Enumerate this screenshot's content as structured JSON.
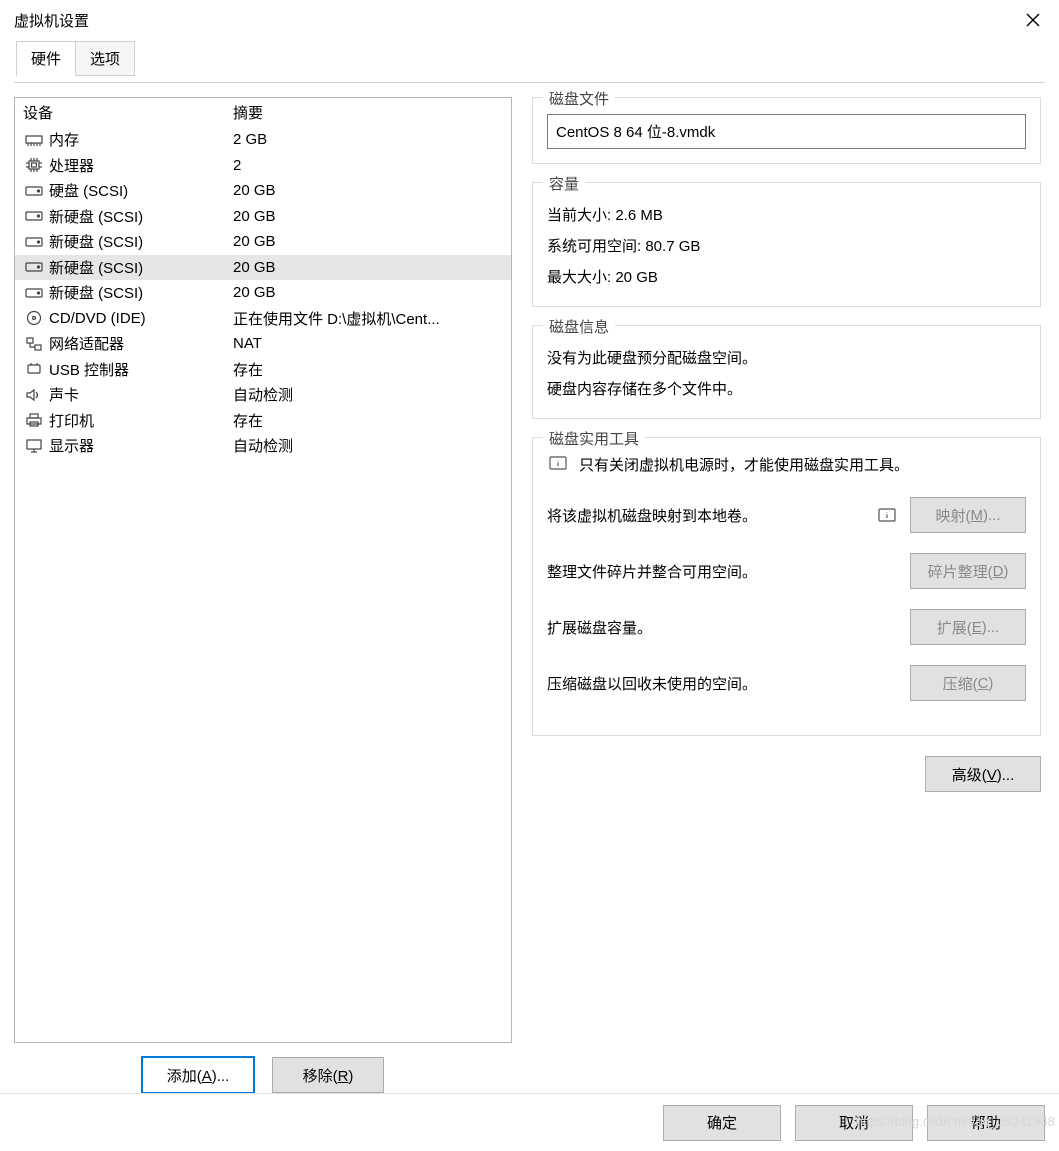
{
  "window": {
    "title": "虚拟机设置"
  },
  "tabs": [
    {
      "label": "硬件",
      "active": true
    },
    {
      "label": "选项",
      "active": false
    }
  ],
  "deviceList": {
    "header": {
      "device": "设备",
      "summary": "摘要"
    },
    "items": [
      {
        "icon": "memory",
        "name": "内存",
        "summary": "2 GB",
        "selected": false
      },
      {
        "icon": "cpu",
        "name": "处理器",
        "summary": "2",
        "selected": false
      },
      {
        "icon": "disk",
        "name": "硬盘 (SCSI)",
        "summary": "20 GB",
        "selected": false
      },
      {
        "icon": "disk",
        "name": "新硬盘 (SCSI)",
        "summary": "20 GB",
        "selected": false
      },
      {
        "icon": "disk",
        "name": "新硬盘 (SCSI)",
        "summary": "20 GB",
        "selected": false
      },
      {
        "icon": "disk",
        "name": "新硬盘 (SCSI)",
        "summary": "20 GB",
        "selected": true
      },
      {
        "icon": "disk",
        "name": "新硬盘 (SCSI)",
        "summary": "20 GB",
        "selected": false
      },
      {
        "icon": "cd",
        "name": "CD/DVD (IDE)",
        "summary": "正在使用文件 D:\\虚拟机\\Cent...",
        "selected": false
      },
      {
        "icon": "net",
        "name": "网络适配器",
        "summary": "NAT",
        "selected": false
      },
      {
        "icon": "usb",
        "name": "USB 控制器",
        "summary": "存在",
        "selected": false
      },
      {
        "icon": "sound",
        "name": "声卡",
        "summary": "自动检测",
        "selected": false
      },
      {
        "icon": "printer",
        "name": "打印机",
        "summary": "存在",
        "selected": false
      },
      {
        "icon": "display",
        "name": "显示器",
        "summary": "自动检测",
        "selected": false
      }
    ]
  },
  "leftActions": {
    "add": "添加(A)...",
    "remove": "移除(R)"
  },
  "right": {
    "diskFile": {
      "legend": "磁盘文件",
      "value": "CentOS 8 64 位-8.vmdk"
    },
    "capacity": {
      "legend": "容量",
      "currentLabel": "当前大小:",
      "currentValue": "2.6 MB",
      "freeLabel": "系统可用空间:",
      "freeValue": "80.7 GB",
      "maxLabel": "最大大小:",
      "maxValue": "20 GB"
    },
    "diskInfo": {
      "legend": "磁盘信息",
      "line1": "没有为此硬盘预分配磁盘空间。",
      "line2": "硬盘内容存储在多个文件中。"
    },
    "utilities": {
      "legend": "磁盘实用工具",
      "notice": "只有关闭虚拟机电源时，才能使用磁盘实用工具。",
      "rows": [
        {
          "desc": "将该虚拟机磁盘映射到本地卷。",
          "hasIcon": true,
          "btn": "映射(M)..."
        },
        {
          "desc": "整理文件碎片并整合可用空间。",
          "hasIcon": false,
          "btn": "碎片整理(D)"
        },
        {
          "desc": "扩展磁盘容量。",
          "hasIcon": false,
          "btn": "扩展(E)..."
        },
        {
          "desc": "压缩磁盘以回收未使用的空间。",
          "hasIcon": false,
          "btn": "压缩(C)"
        }
      ]
    },
    "advanced": "高级(V)..."
  },
  "footer": {
    "ok": "确定",
    "cancel": "取消",
    "help": "帮助"
  },
  "watermark": "https://blog.csdn.net/qq_38241948"
}
